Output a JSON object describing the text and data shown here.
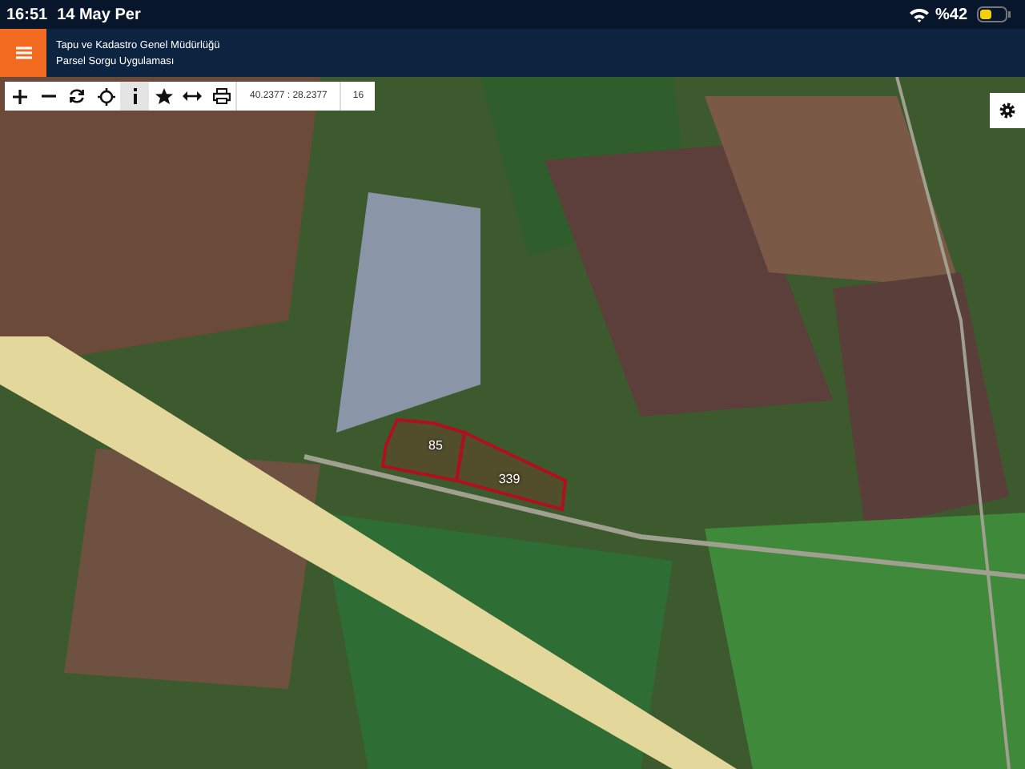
{
  "status_bar": {
    "time": "16:51",
    "date": "14 May Per",
    "battery": "%42"
  },
  "header": {
    "title": "Tapu ve Kadastro Genel Müdürlüğü",
    "subtitle": "Parsel Sorgu Uygulaması"
  },
  "toolbar": {
    "tools": [
      {
        "kind": "zoom-in",
        "selected": false
      },
      {
        "kind": "zoom-out",
        "selected": false
      },
      {
        "kind": "refresh",
        "selected": false
      },
      {
        "kind": "locate",
        "selected": false
      },
      {
        "kind": "info",
        "selected": true
      },
      {
        "kind": "star",
        "selected": false
      },
      {
        "kind": "measure",
        "selected": false
      },
      {
        "kind": "print",
        "selected": false
      }
    ],
    "coordinates": "40.2377 : 28.2377",
    "zoom": "16"
  },
  "parcels": [
    {
      "label": "85"
    },
    {
      "label": "339"
    }
  ]
}
